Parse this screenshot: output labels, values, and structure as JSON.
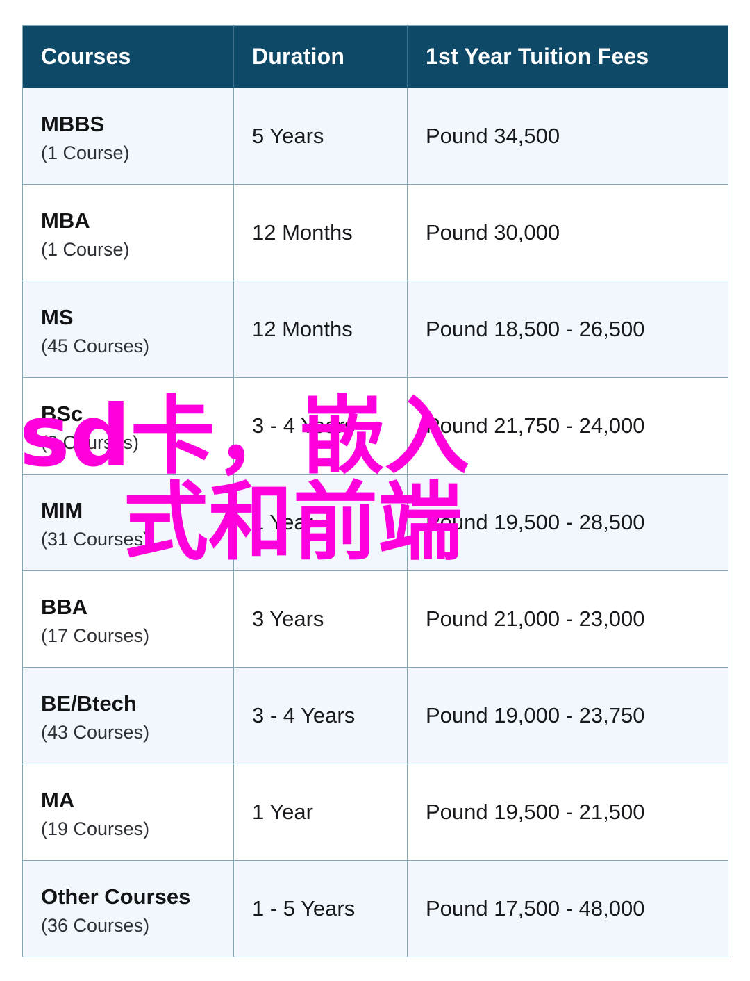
{
  "table": {
    "columns": [
      "Courses",
      "Duration",
      "1st Year Tuition Fees"
    ],
    "rows": [
      {
        "course": "MBBS",
        "count": "(1 Course)",
        "duration": "5 Years",
        "fees": "Pound 34,500"
      },
      {
        "course": "MBA",
        "count": "(1 Course)",
        "duration": "12 Months",
        "fees": "Pound 30,000"
      },
      {
        "course": "MS",
        "count": "(45 Courses)",
        "duration": "12 Months",
        "fees": "Pound 18,500 - 26,500"
      },
      {
        "course": "BSc",
        "count": "(8 Courses)",
        "duration": "3 - 4 Years",
        "fees": "Pound 21,750 - 24,000"
      },
      {
        "course": "MIM",
        "count": "(31 Courses)",
        "duration": "1 Year",
        "fees": "Pound 19,500 - 28,500"
      },
      {
        "course": "BBA",
        "count": "(17 Courses)",
        "duration": "3 Years",
        "fees": "Pound 21,000 - 23,000"
      },
      {
        "course": "BE/Btech",
        "count": "(43 Courses)",
        "duration": "3 - 4 Years",
        "fees": "Pound 19,000 - 23,750"
      },
      {
        "course": "MA",
        "count": "(19 Courses)",
        "duration": "1 Year",
        "fees": "Pound 19,500 - 21,500"
      },
      {
        "course": "Other Courses",
        "count": "(36 Courses)",
        "duration": "1 - 5 Years",
        "fees": "Pound 17,500 - 48,000"
      }
    ]
  },
  "overlay": {
    "line1": "sd卡，嵌入",
    "line2": "式和前端",
    "color": "#ff00dd"
  },
  "colors": {
    "header_background": "#0e4a68",
    "header_text": "#ffffff",
    "row_tint": "#f2f7fd",
    "row_plain": "#ffffff",
    "border": "#84a5b1",
    "body_text": "#17191c",
    "overlay_magenta": "#ff00dd"
  }
}
